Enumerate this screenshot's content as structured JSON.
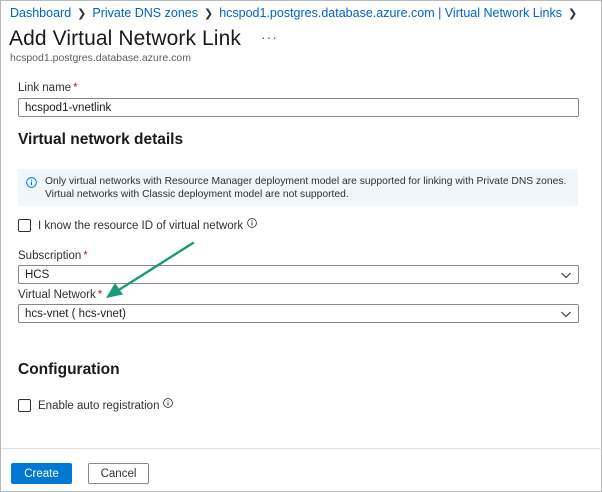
{
  "breadcrumb": {
    "items": [
      "Dashboard",
      "Private DNS zones",
      "hcspod1.postgres.database.azure.com | Virtual Network Links"
    ]
  },
  "header": {
    "title": "Add Virtual Network Link",
    "more": "···",
    "subtitle": "hcspod1.postgres.database.azure.com"
  },
  "link_name": {
    "label": "Link name",
    "required": "*",
    "value": "hcspod1-vnetlink"
  },
  "vnet_details": {
    "heading": "Virtual network details",
    "info": "Only virtual networks with Resource Manager deployment model are supported for linking with Private DNS zones. Virtual networks with Classic deployment model are not supported.",
    "resource_id_checkbox": {
      "label": "I know the resource ID of virtual network",
      "checked": false
    },
    "subscription": {
      "label": "Subscription",
      "required": "*",
      "value": "HCS"
    },
    "virtual_network": {
      "label": "Virtual Network",
      "required": "*",
      "value": "hcs-vnet ( hcs-vnet)"
    }
  },
  "configuration": {
    "heading": "Configuration",
    "auto_registration": {
      "label": "Enable auto registration",
      "checked": false
    }
  },
  "footer": {
    "create": "Create",
    "cancel": "Cancel"
  },
  "colors": {
    "link": "#0062c4",
    "primary": "#0078d4",
    "info_bg": "#eff6fc",
    "annotation_arrow": "#1a9b78"
  },
  "icons": [
    "chevron-right-icon",
    "chevron-down-icon",
    "info-icon",
    "annotation-arrow"
  ]
}
